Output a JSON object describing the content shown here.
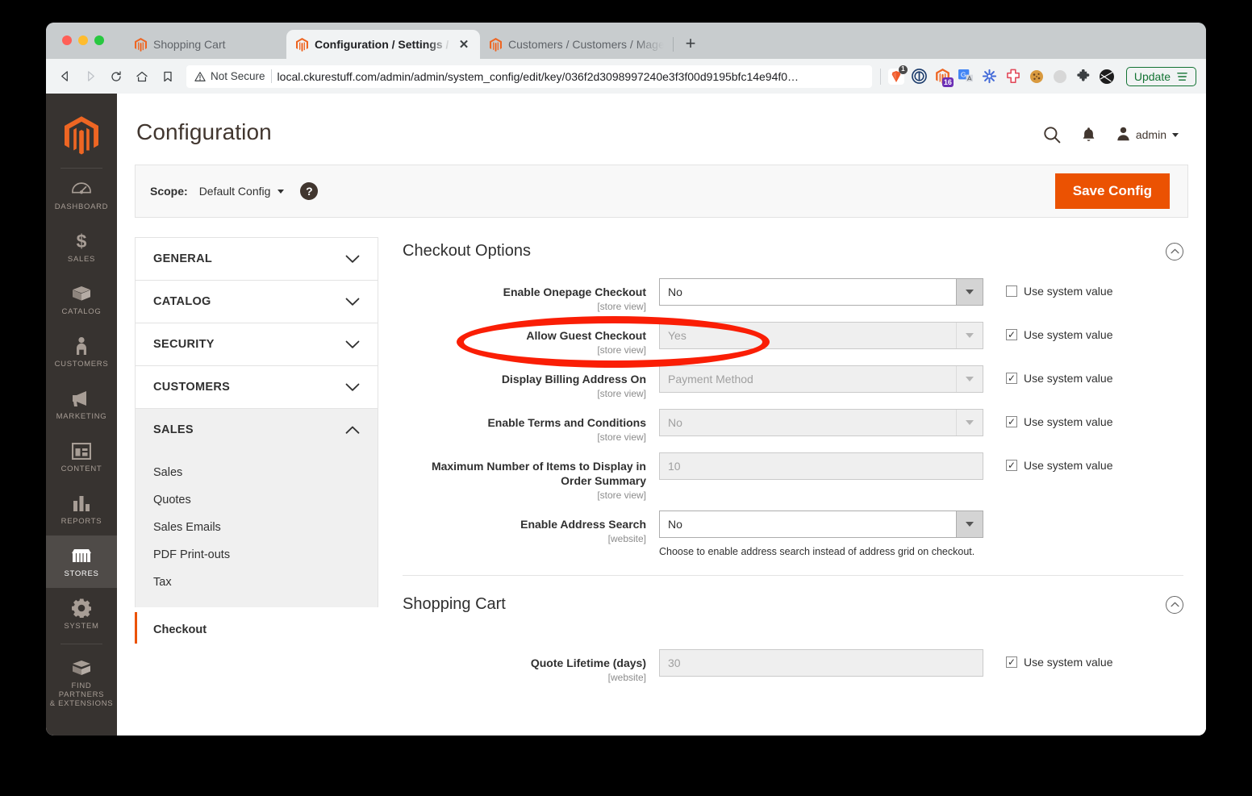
{
  "browser": {
    "tabs": [
      {
        "title": "Shopping Cart",
        "active": false,
        "icon": "magento-favicon"
      },
      {
        "title": "Configuration / Settings / Stores",
        "active": true,
        "icon": "magento-favicon"
      },
      {
        "title": "Customers / Customers / Magento A",
        "active": false,
        "icon": "magento-favicon"
      }
    ],
    "new_tab_label": "+",
    "close_label": "✕",
    "security_label": "Not Secure",
    "url": "local.ckurestuff.com/admin/admin/system_config/edit/key/036f2d3098997240e3f3f00d9195bfc14e94f0…",
    "update_label": "Update",
    "extensions": [
      {
        "name": "brave-shields-icon",
        "badge": "1"
      },
      {
        "name": "onepassword-icon",
        "badge": ""
      },
      {
        "name": "magento-extension-icon",
        "badge": "16"
      },
      {
        "name": "google-translate-icon",
        "badge": ""
      },
      {
        "name": "asterisk-extension-icon",
        "badge": ""
      },
      {
        "name": "cross-extension-icon",
        "badge": ""
      },
      {
        "name": "cookie-editor-icon",
        "badge": ""
      },
      {
        "name": "grey-circle-extension-icon",
        "badge": ""
      },
      {
        "name": "puzzle-extensions-icon",
        "badge": ""
      },
      {
        "name": "dark-sphere-extension-icon",
        "badge": ""
      }
    ]
  },
  "admin_nav": {
    "logo": "magento-logo",
    "items": [
      {
        "label": "DASHBOARD",
        "icon": "gauge-icon",
        "active": false
      },
      {
        "label": "SALES",
        "icon": "dollar-icon",
        "active": false
      },
      {
        "label": "CATALOG",
        "icon": "box-icon",
        "active": false
      },
      {
        "label": "CUSTOMERS",
        "icon": "person-icon",
        "active": false
      },
      {
        "label": "MARKETING",
        "icon": "megaphone-icon",
        "active": false
      },
      {
        "label": "CONTENT",
        "icon": "layout-icon",
        "active": false
      },
      {
        "label": "REPORTS",
        "icon": "bar-chart-icon",
        "active": false
      },
      {
        "label": "STORES",
        "icon": "storefront-icon",
        "active": true
      },
      {
        "label": "SYSTEM",
        "icon": "gear-icon",
        "active": false
      },
      {
        "label": "FIND PARTNERS\n& EXTENSIONS",
        "icon": "extensions-box-icon",
        "active": false
      }
    ],
    "find_partners_line1": "FIND PARTNERS",
    "find_partners_line2": "& EXTENSIONS"
  },
  "header": {
    "title": "Configuration",
    "user_name": "admin",
    "search_icon": "search-icon",
    "notifications_icon": "bell-icon",
    "avatar_icon": "user-avatar-icon"
  },
  "scope_bar": {
    "label": "Scope:",
    "value": "Default Config",
    "help_glyph": "?",
    "save_label": "Save Config",
    "accent": "#eb5202"
  },
  "config_nav": {
    "sections": [
      {
        "label": "GENERAL",
        "open": false
      },
      {
        "label": "CATALOG",
        "open": false
      },
      {
        "label": "SECURITY",
        "open": false
      },
      {
        "label": "CUSTOMERS",
        "open": false
      },
      {
        "label": "SALES",
        "open": true
      }
    ],
    "sales_items": [
      "Sales",
      "Quotes",
      "Sales Emails",
      "PDF Print-outs",
      "Tax"
    ],
    "active_item": "Checkout"
  },
  "sections": [
    {
      "title": "Checkout Options",
      "collapse_icon": "chevron-up-circle-icon",
      "fields": [
        {
          "label": "Enable Onepage Checkout",
          "scope": "[store view]",
          "type": "select",
          "value": "No",
          "disabled": false,
          "use_system_value": false,
          "use_system_label": "Use system value",
          "note": ""
        },
        {
          "label": "Allow Guest Checkout",
          "scope": "[store view]",
          "type": "select",
          "value": "Yes",
          "disabled": true,
          "use_system_value": true,
          "use_system_label": "Use system value",
          "note": ""
        },
        {
          "label": "Display Billing Address On",
          "scope": "[store view]",
          "type": "select",
          "value": "Payment Method",
          "disabled": true,
          "use_system_value": true,
          "use_system_label": "Use system value",
          "note": ""
        },
        {
          "label": "Enable Terms and Conditions",
          "scope": "[store view]",
          "type": "select",
          "value": "No",
          "disabled": true,
          "use_system_value": true,
          "use_system_label": "Use system value",
          "note": ""
        },
        {
          "label": "Maximum Number of Items to Display in Order Summary",
          "scope": "[store view]",
          "type": "text",
          "value": "10",
          "disabled": true,
          "use_system_value": true,
          "use_system_label": "Use system value",
          "note": ""
        },
        {
          "label": "Enable Address Search",
          "scope": "[website]",
          "type": "select",
          "value": "No",
          "disabled": false,
          "use_system_value": null,
          "use_system_label": "",
          "note": "Choose to enable address search instead of address grid on checkout."
        }
      ]
    },
    {
      "title": "Shopping Cart",
      "collapse_icon": "chevron-up-circle-icon",
      "fields": [
        {
          "label": "Quote Lifetime (days)",
          "scope": "[website]",
          "type": "text",
          "value": "30",
          "disabled": true,
          "use_system_value": true,
          "use_system_label": "Use system value",
          "note": ""
        }
      ]
    }
  ],
  "annotation": {
    "shape": "ellipse",
    "color": "#fa1e05",
    "targets": "Enable Onepage Checkout"
  }
}
